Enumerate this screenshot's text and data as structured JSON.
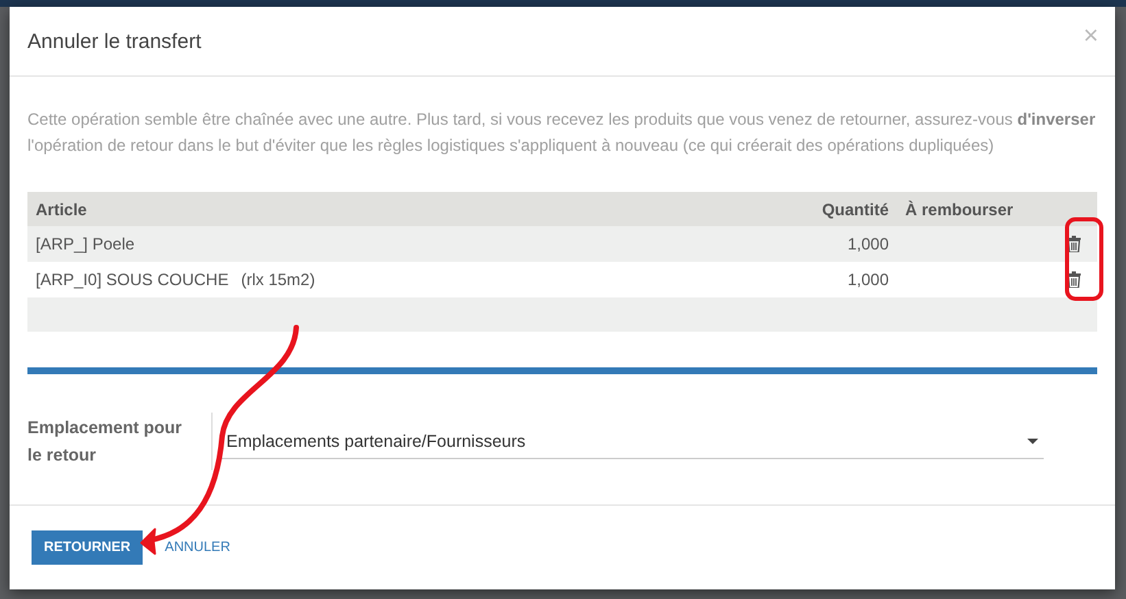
{
  "dialog": {
    "title": "Annuler le transfert",
    "close": "×",
    "message": "Cette opération semble être chaînée avec une autre. Plus tard, si vous recevez les produits que vous venez de retourner, assurez-vous **d'inverser** l'opération de retour dans le but d'éviter que les règles logistiques s'appliquent à nouveau (ce qui créerait des opérations dupliquées)",
    "table": {
      "columns": [
        "Article",
        "Quantité",
        "À rembourser"
      ],
      "rows": [
        {
          "article": "[ARP_] Poele",
          "quantity": "1,000"
        },
        {
          "article": "[ARP_I0] SOUS COUCHE",
          "note": "(rlx 15m2)",
          "quantity": "1,000"
        }
      ]
    },
    "location": {
      "label": "Emplacement pour le retour",
      "value": "Emplacements partenaire/Fournisseurs"
    },
    "buttons": [
      {
        "label": "RETOURNER",
        "kind": "primary"
      },
      {
        "label": "ANNULER",
        "kind": "link"
      }
    ]
  }
}
